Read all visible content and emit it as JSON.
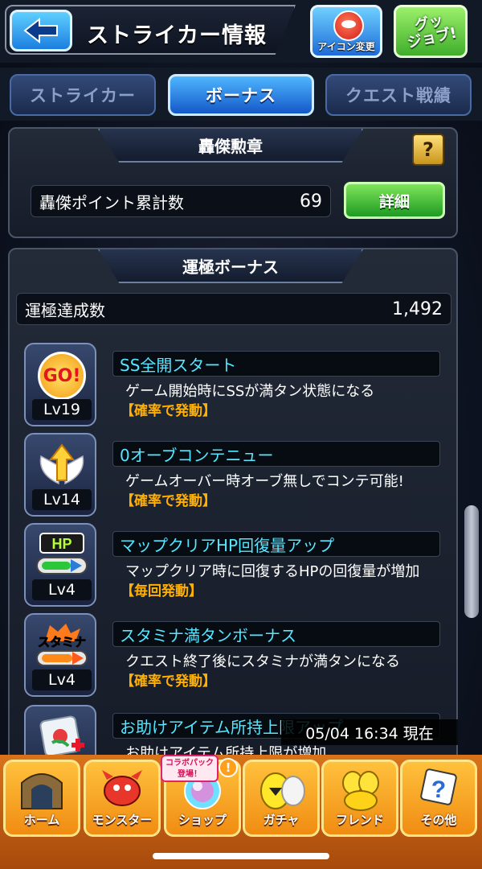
{
  "header": {
    "title": "ストライカー情報",
    "icon_change_label": "アイコン変更",
    "good_job_label": "グッ\nジョブ!"
  },
  "tabs": [
    {
      "label": "ストライカー",
      "active": false
    },
    {
      "label": "ボーナス",
      "active": true
    },
    {
      "label": "クエスト戦績",
      "active": false
    }
  ],
  "medal_panel": {
    "heading": "轟傑勲章",
    "help_label": "?",
    "points_label": "轟傑ポイント累計数",
    "points_value": "69",
    "detail_button": "詳細"
  },
  "luck_panel": {
    "heading": "運極ボーナス",
    "achieved_label": "運極達成数",
    "achieved_value": "1,492",
    "bonuses": [
      {
        "icon": "go-icon",
        "icon_text": "GO!",
        "level": "Lv19",
        "name": "SS全開スタート",
        "description": "ゲーム開始時にSSが満タン状態になる",
        "trigger": "【確率で発動】"
      },
      {
        "icon": "winged-arrow-icon",
        "level": "Lv14",
        "name": "0オーブコンテニュー",
        "description": "ゲームオーバー時オーブ無しでコンテ可能!",
        "trigger": "【確率で発動】"
      },
      {
        "icon": "hp-gauge-icon",
        "icon_text": "HP",
        "level": "Lv4",
        "name": "マップクリアHP回復量アップ",
        "description": "マップクリア時に回復するHPの回復量が増加",
        "trigger": "【毎回発動】"
      },
      {
        "icon": "stamina-icon",
        "icon_text": "スタミナ",
        "level": "Lv4",
        "name": "スタミナ満タンボーナス",
        "description": "クエスト終了後にスタミナが満タンになる",
        "trigger": "【確率で発動】"
      },
      {
        "icon": "helper-item-icon",
        "level": "",
        "name": "お助けアイテム所持上限アップ",
        "description": "お助けアイテム所持上限が増加",
        "trigger": ""
      }
    ]
  },
  "timestamp": "05/04 16:34 現在",
  "bottom_nav": {
    "collab_tag": "コラボパック\n登場！",
    "alert": "!",
    "items": [
      {
        "label": "ホーム",
        "icon": "home-gate-icon"
      },
      {
        "label": "モンスター",
        "icon": "dragon-icon"
      },
      {
        "label": "ショップ",
        "icon": "orb-icon"
      },
      {
        "label": "ガチャ",
        "icon": "egg-icon"
      },
      {
        "label": "フレンド",
        "icon": "friend-icon"
      },
      {
        "label": "その他",
        "icon": "question-box-icon"
      }
    ]
  },
  "colors": {
    "accent_cyan": "#57e6ff",
    "trigger_orange": "#ffb000",
    "tab_active": "#1458c8",
    "detail_green": "#1e9a23",
    "nav_orange": "#f08c12"
  }
}
